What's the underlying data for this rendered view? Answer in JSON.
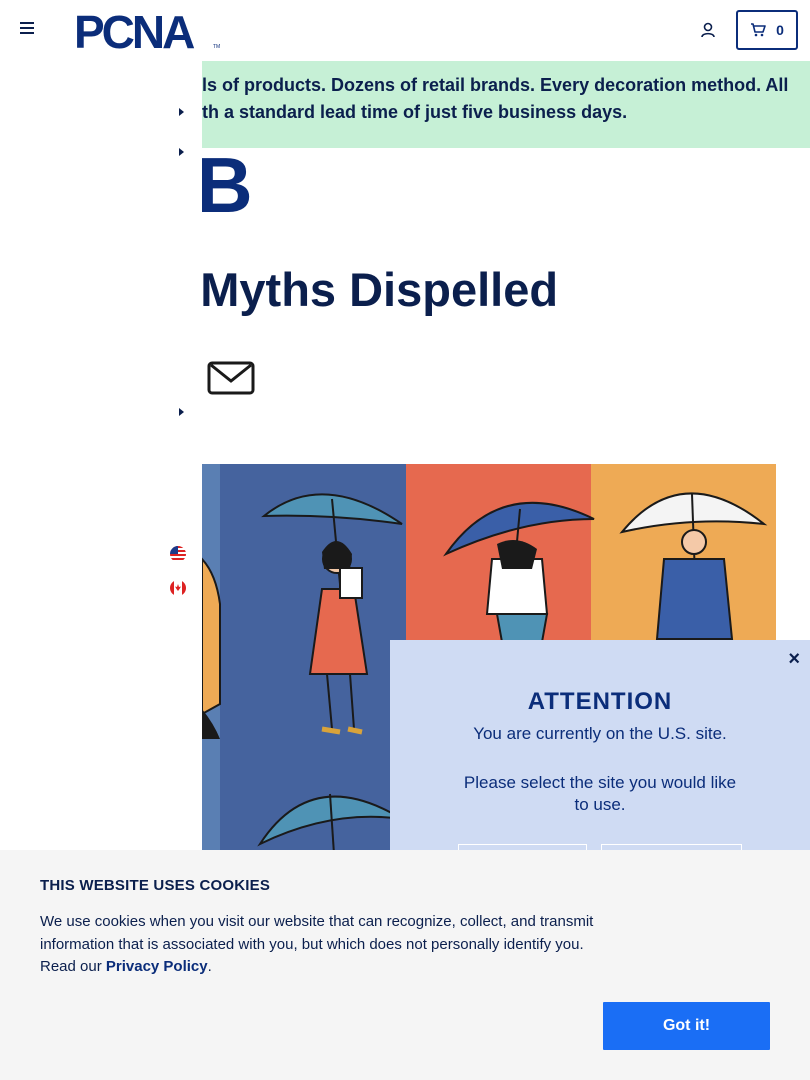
{
  "header": {
    "logo_text": "PCNA",
    "logo_tm": "TM",
    "cart_count": "0"
  },
  "banner": {
    "line1": "ls of products. Dozens of retail brands. Every decoration method. All",
    "line2": "th a standard lead time of just five business days."
  },
  "content": {
    "hub_fragment": "UB",
    "title_fragment": "la Myths Dispelled"
  },
  "nav": {
    "flags": [
      "us-flag",
      "canada-flag"
    ]
  },
  "modal": {
    "close_label": "×",
    "title": "ATTENTION",
    "line1": "You are currently on the U.S. site.",
    "line2": "Please select the site you would like to use."
  },
  "cookie": {
    "title": "THIS WEBSITE USES COOKIES",
    "text_before": "We use cookies when you visit our website that can recognize, collect, and transmit information that is associated with you, but which does not personally identify you. Read our ",
    "link_text": "Privacy Policy",
    "text_after": ".",
    "button_label": "Got it!"
  },
  "colors": {
    "brand_navy": "#0b2d7a",
    "banner_green": "#c6f0d6",
    "modal_bg": "#cfdbf3",
    "cookie_button": "#1a6ef5"
  }
}
